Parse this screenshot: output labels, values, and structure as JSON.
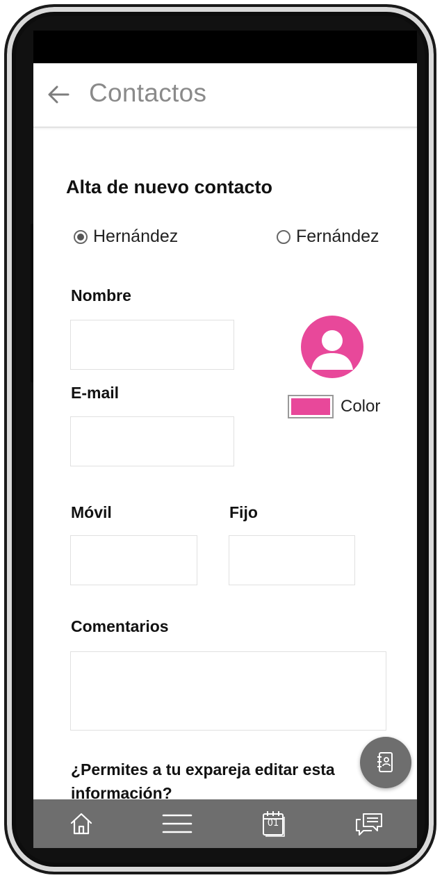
{
  "app_bar": {
    "title": "Contactos",
    "back_icon": "arrow-left-icon"
  },
  "form": {
    "title": "Alta de nuevo contacto",
    "radio_options": [
      {
        "label": "Hernández",
        "selected": true
      },
      {
        "label": "Fernández",
        "selected": false
      }
    ],
    "name_label": "Nombre",
    "email_label": "E-mail",
    "mobile_label": "Móvil",
    "landline_label": "Fijo",
    "comments_label": "Comentarios",
    "color_label": "Color",
    "color_value": "#e8489a",
    "avatar_icon": "person-avatar-icon",
    "question": "¿Permites a tu expareja editar esta información?"
  },
  "fab": {
    "icon": "contact-book-icon"
  },
  "bottom_nav": {
    "items": [
      {
        "icon": "home-icon"
      },
      {
        "icon": "menu-icon"
      },
      {
        "icon": "calendar-icon",
        "day": "01"
      },
      {
        "icon": "chat-icon"
      }
    ]
  },
  "colors": {
    "accent": "#e8489a",
    "nav_background": "#6e6e6e",
    "status_bar": "#000000"
  }
}
